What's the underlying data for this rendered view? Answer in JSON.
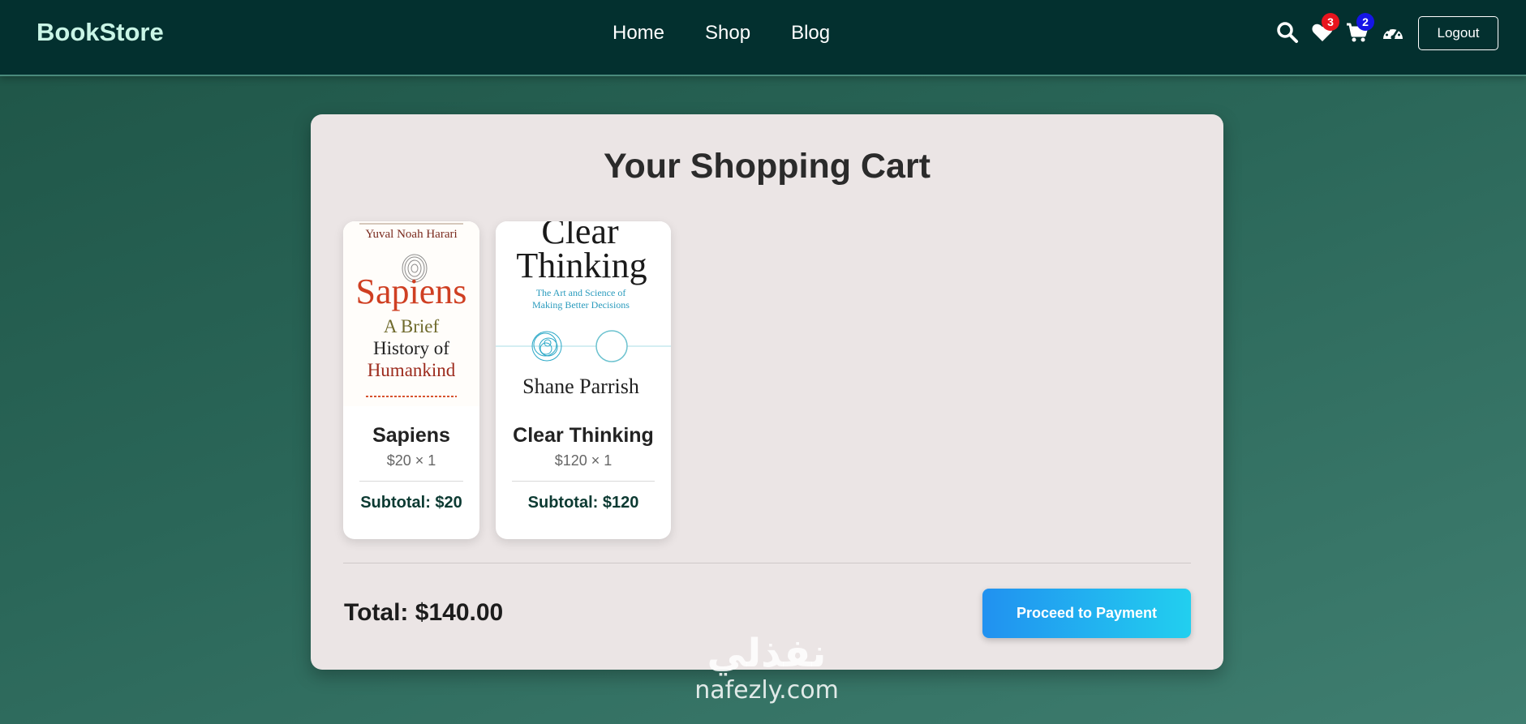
{
  "navbar": {
    "brand": "BookStore",
    "links": [
      "Home",
      "Shop",
      "Blog"
    ],
    "icons": {
      "search": "search-icon",
      "wishlist": "heart-icon",
      "cart": "cart-icon",
      "dashboard": "dashboard-icon"
    },
    "wishlist_count": "3",
    "cart_count": "2",
    "logout_label": "Logout"
  },
  "cart": {
    "title": "Your Shopping Cart",
    "items": [
      {
        "name": "Sapiens",
        "price_line": "$20 × 1",
        "subtotal": "Subtotal: $20",
        "cover": {
          "author": "Yuval Noah Harari",
          "title": "Sapiens",
          "subtitle_lines": [
            "A Brief",
            "History of",
            "Humankind"
          ]
        }
      },
      {
        "name": "Clear Thinking",
        "price_line": "$120 × 1",
        "subtotal": "Subtotal: $120",
        "cover": {
          "title_lines": [
            "Clear",
            "Thinking"
          ],
          "subtitle_lines": [
            "The Art and Science of",
            "Making Better Decisions"
          ],
          "author": "Shane Parrish"
        }
      }
    ],
    "total": "Total: $140.00",
    "pay_label": "Proceed to Payment"
  },
  "watermark": {
    "arabic": "نفذلي",
    "latin": "nafezly.com"
  },
  "colors": {
    "navbar_bg": "#03302f",
    "page_bg": "#2a6658",
    "card_bg": "#ebe5e5",
    "badge_wishlist": "#e8141e",
    "badge_cart": "#1515e6",
    "pay_button_start": "#2191f0",
    "pay_button_end": "#22cfef"
  }
}
